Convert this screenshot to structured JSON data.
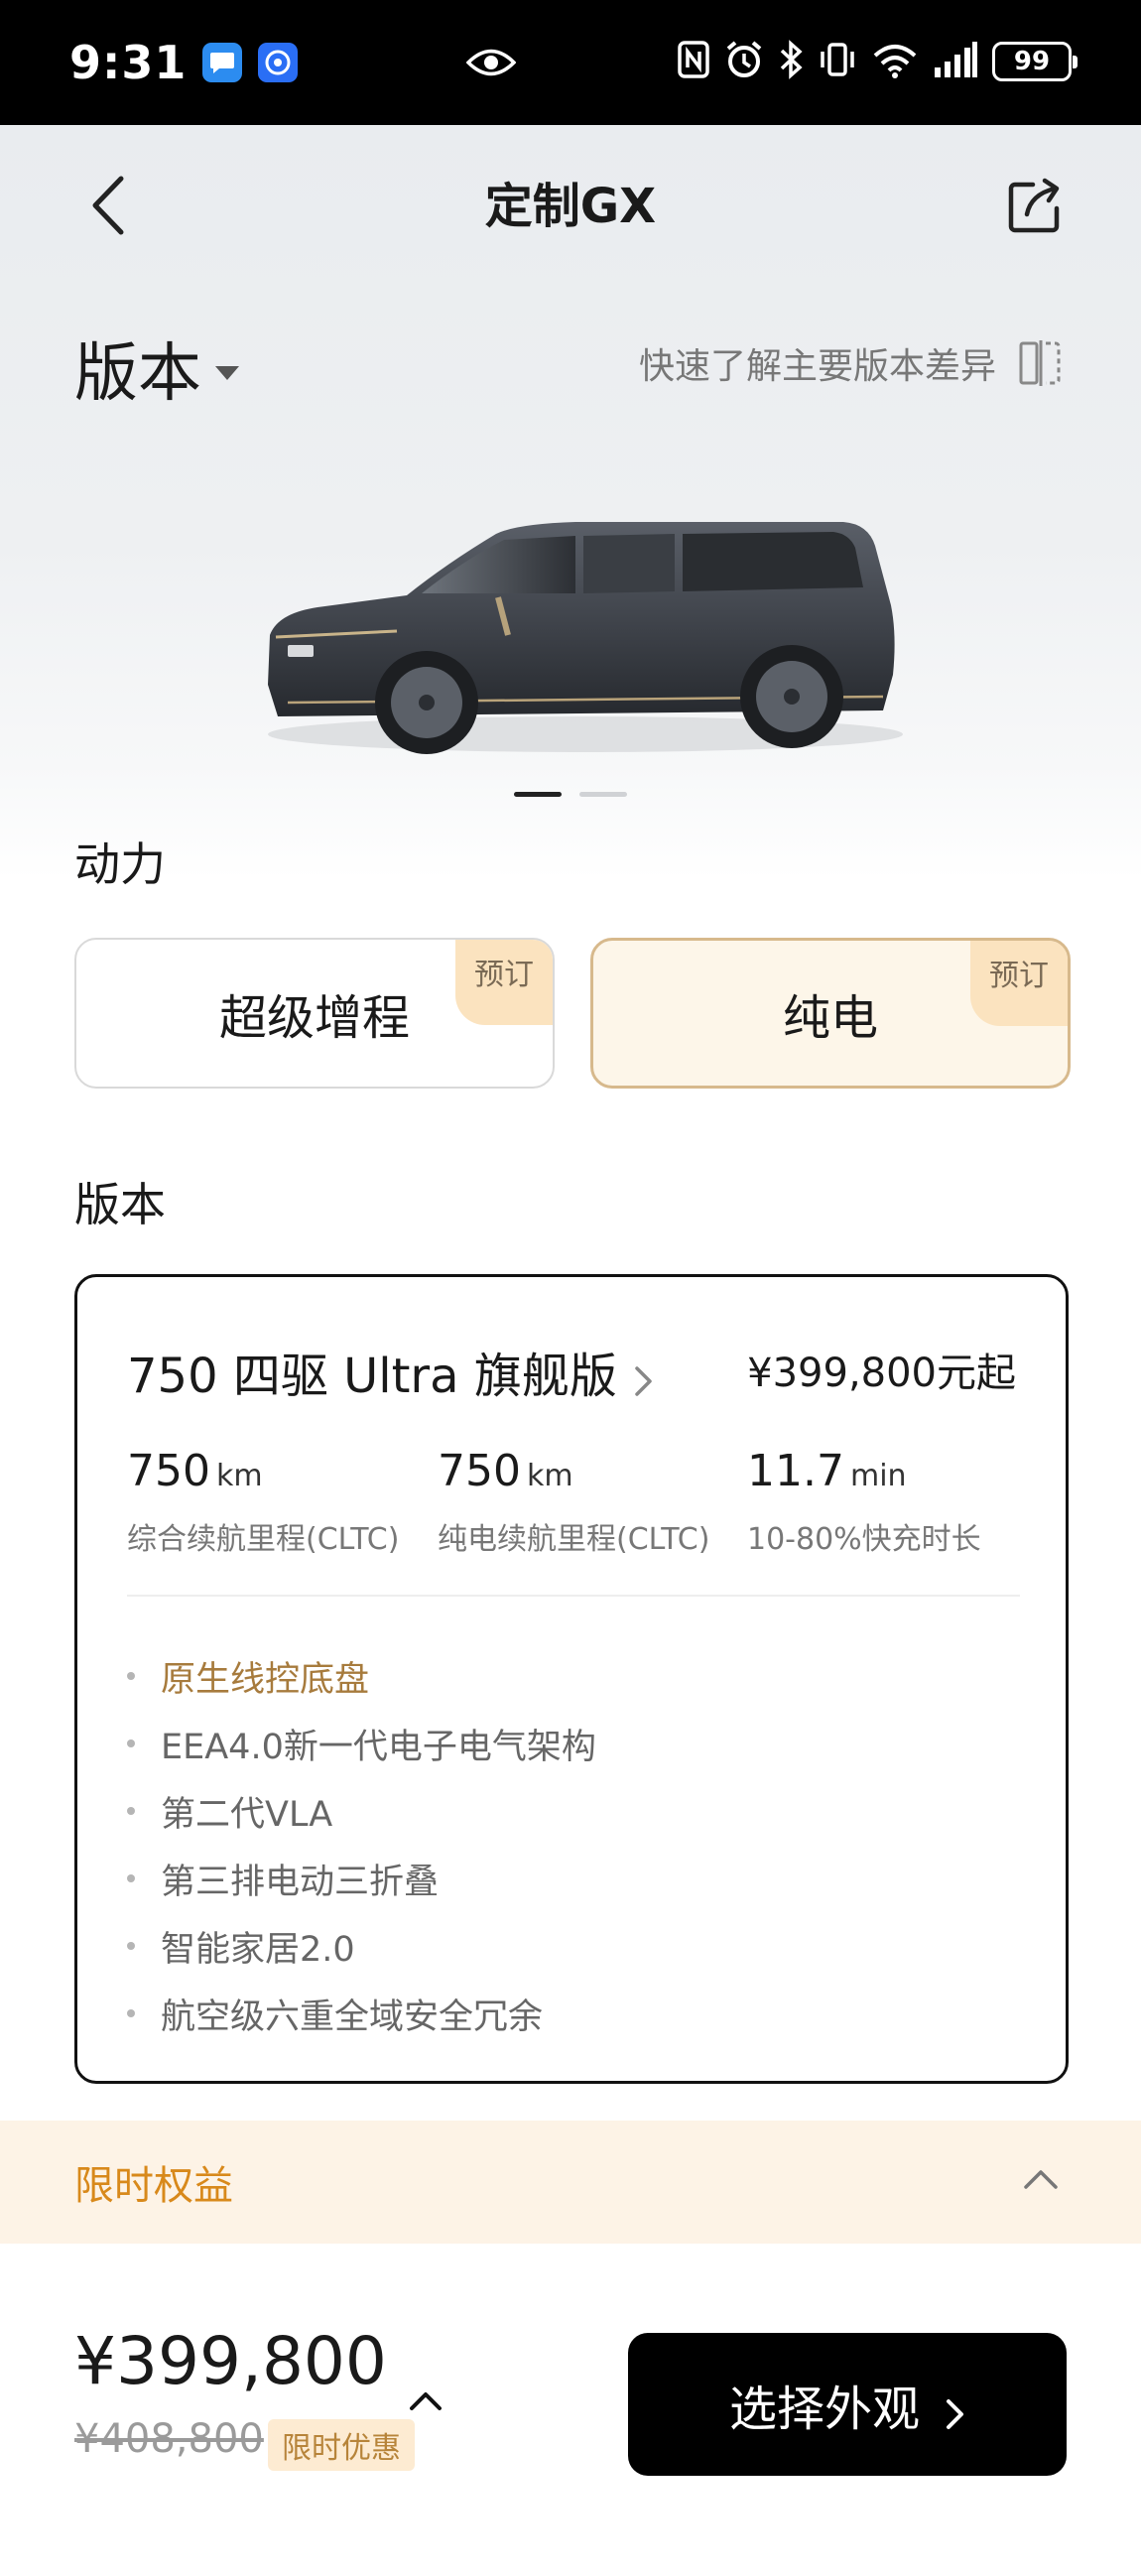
{
  "status_bar": {
    "time": "9:31",
    "battery": "99",
    "icons": [
      "message-app-icon",
      "browser-app-icon",
      "eye-icon",
      "nfc-icon",
      "alarm-icon",
      "bluetooth-icon",
      "vibrate-icon",
      "wifi-icon",
      "signal-icon",
      "battery-icon"
    ]
  },
  "nav": {
    "title": "定制GX",
    "back_icon": "back-chevron-icon",
    "share_icon": "share-icon"
  },
  "header": {
    "version_label": "版本",
    "compare_link": "快速了解主要版本差异",
    "compare_icon": "compare-icon"
  },
  "carousel": {
    "total_slides": 2,
    "active_slide": 1
  },
  "power": {
    "title": "动力",
    "options": [
      {
        "label": "超级增程",
        "tag": "预订",
        "selected": false
      },
      {
        "label": "纯电",
        "tag": "预订",
        "selected": true
      }
    ]
  },
  "version": {
    "title": "版本",
    "name": "750 四驱 Ultra 旗舰版",
    "price": "¥399,800元起",
    "specs": [
      {
        "value": "750",
        "unit": "km",
        "label": "综合续航里程(CLTC)"
      },
      {
        "value": "750",
        "unit": "km",
        "label": "纯电续航里程(CLTC)"
      },
      {
        "value": "11.7",
        "unit": "min",
        "label": "10-80%快充时长"
      }
    ],
    "features": [
      {
        "text": "原生线控底盘",
        "highlight": true
      },
      {
        "text": "EEA4.0新一代电子电气架构",
        "highlight": false
      },
      {
        "text": "第二代VLA",
        "highlight": false
      },
      {
        "text": "第三排电动三折叠",
        "highlight": false
      },
      {
        "text": "智能家居2.0",
        "highlight": false
      },
      {
        "text": "航空级六重全域安全冗余",
        "highlight": false
      }
    ]
  },
  "benefits": {
    "label": "限时权益",
    "toggle_icon": "chevron-up-icon"
  },
  "bottom": {
    "price": "¥399,800",
    "original_price": "¥408,800",
    "promo": "限时优惠",
    "cta": "选择外观"
  },
  "colors": {
    "accent_gold": "#a77b3d",
    "benefits_orange": "#d8891b",
    "selected_bg": "#fdf6e9",
    "tag_bg": "#fbe3bf"
  }
}
